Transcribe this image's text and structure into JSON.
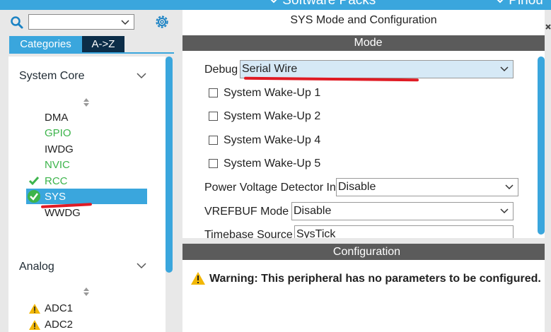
{
  "topbar": {
    "item_software_packs": "Software Packs",
    "item_pinout": "Pinou"
  },
  "left": {
    "tabs": {
      "categories": "Categories",
      "az": "A->Z"
    },
    "groups": [
      {
        "label": "System Core",
        "items": [
          "DMA",
          "GPIO",
          "IWDG",
          "NVIC",
          "RCC",
          "SYS",
          "WWDG"
        ]
      },
      {
        "label": "Analog",
        "items": [
          "ADC1",
          "ADC2"
        ]
      }
    ]
  },
  "right": {
    "title": "SYS Mode and Configuration",
    "mode_header": "Mode",
    "debug": {
      "label": "Debug",
      "value": "Serial Wire"
    },
    "wakeups": [
      "System Wake-Up 1",
      "System Wake-Up 2",
      "System Wake-Up 4",
      "System Wake-Up 5"
    ],
    "pvd": {
      "label": "Power Voltage Detector In",
      "value": "Disable"
    },
    "vrefbuf": {
      "label": "VREFBUF Mode",
      "value": "Disable"
    },
    "timebase": {
      "label": "Timebase Source",
      "value": "SysTick"
    },
    "config_header": "Configuration",
    "warning": "Warning: This peripheral has no parameters to be configured."
  },
  "colors": {
    "accent": "#3aa6dd",
    "header": "#5b5b5b",
    "green": "#3cb44b",
    "warning": "#f2b705",
    "annotation": "#e01b24"
  }
}
